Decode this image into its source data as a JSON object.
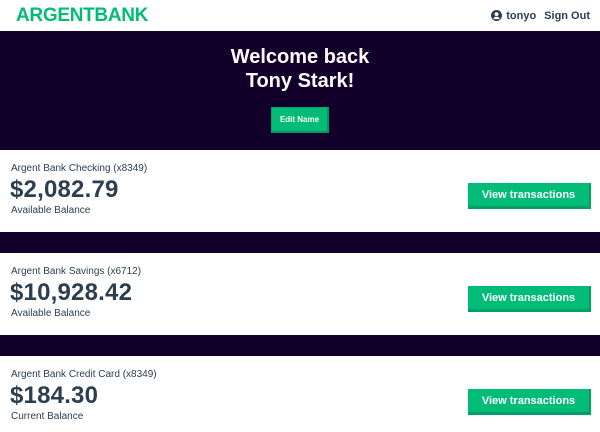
{
  "header": {
    "logo_argent": "ARGENT",
    "logo_bank": "BANK",
    "username": "tonyo",
    "signout_label": "Sign Out"
  },
  "hero": {
    "line1": "Welcome back",
    "line2": "Tony Stark!",
    "edit_label": "Edit Name"
  },
  "accounts": [
    {
      "title": "Argent Bank Checking (x8349)",
      "amount": "$2,082.79",
      "description": "Available Balance",
      "button_label": "View transactions"
    },
    {
      "title": "Argent Bank Savings (x6712)",
      "amount": "$10,928.42",
      "description": "Available Balance",
      "button_label": "View transactions"
    },
    {
      "title": "Argent Bank Credit Card (x8349)",
      "amount": "$184.30",
      "description": "Current Balance",
      "button_label": "View transactions"
    }
  ],
  "colors": {
    "brand_green": "#00bc77",
    "hero_background": "#12002b",
    "text": "#2c3e50"
  },
  "icons": {
    "user": "user-circle-icon"
  }
}
